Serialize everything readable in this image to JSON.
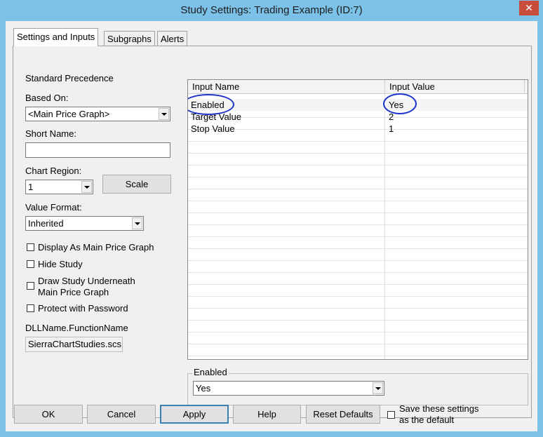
{
  "window": {
    "title": "Study Settings: Trading Example (ID:7)",
    "close_glyph": "✕"
  },
  "tabs": [
    {
      "label": "Settings and Inputs",
      "active": true
    },
    {
      "label": "Subgraphs",
      "active": false
    },
    {
      "label": "Alerts",
      "active": false
    }
  ],
  "left": {
    "standard_precedence": "Standard Precedence",
    "based_on_label": "Based On:",
    "based_on_value": "<Main Price Graph>",
    "short_name_label": "Short Name:",
    "short_name_value": "",
    "chart_region_label": "Chart Region:",
    "chart_region_value": "1",
    "scale_button": "Scale",
    "value_format_label": "Value Format:",
    "value_format_value": "Inherited",
    "checkboxes": [
      {
        "label": "Display As Main Price Graph",
        "checked": false
      },
      {
        "label": "Hide Study",
        "checked": false
      },
      {
        "label": "Draw Study Underneath",
        "label2": "Main Price Graph",
        "checked": false
      },
      {
        "label": "Protect with Password",
        "checked": false
      }
    ],
    "dll_label": "DLLName.FunctionName",
    "dll_value": "SierraChartStudies.scs"
  },
  "grid": {
    "headers": [
      "Input Name",
      "Input Value"
    ],
    "rows": [
      {
        "name": "Enabled",
        "value": "Yes"
      },
      {
        "name": "Target Value",
        "value": "2"
      },
      {
        "name": "Stop Value",
        "value": "1"
      }
    ],
    "annotation_color": "#1d34c9"
  },
  "editor": {
    "group_label": "Enabled",
    "value": "Yes"
  },
  "footer": {
    "ok": "OK",
    "cancel": "Cancel",
    "apply": "Apply",
    "help": "Help",
    "reset_defaults": "Reset Defaults",
    "save_default_line1": "Save these settings",
    "save_default_line2": "as the default",
    "save_default_checked": false
  }
}
